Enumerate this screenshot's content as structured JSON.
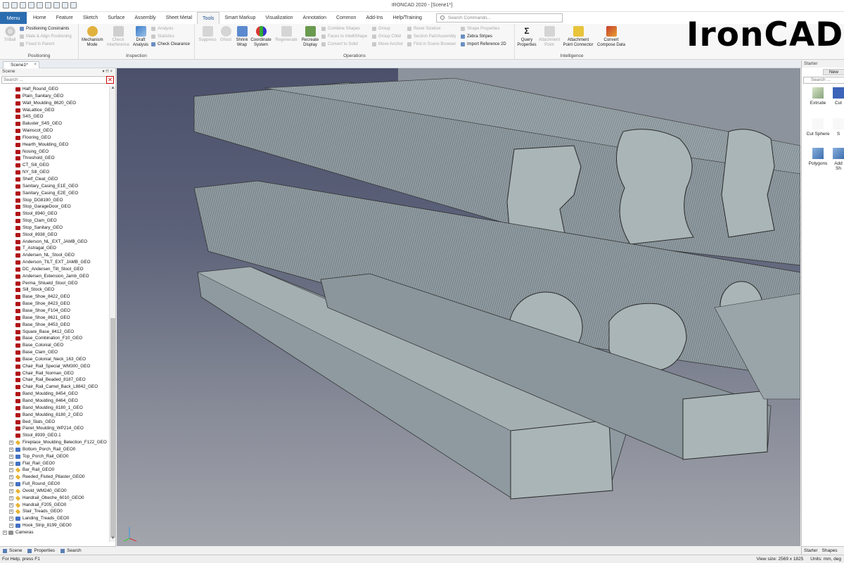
{
  "window": {
    "title": "IRONCAD 2020 - [Scene1*]"
  },
  "menu_button": "Menu",
  "tabs": [
    "Home",
    "Feature",
    "Sketch",
    "Surface",
    "Assembly",
    "Sheet Metal",
    "Tools",
    "Smart Markup",
    "Visualization",
    "Annotation",
    "Common",
    "Add-Ins",
    "Help/Training"
  ],
  "active_tab": "Tools",
  "search_commands": {
    "placeholder": "Search Commands..."
  },
  "logo_text": "IronCAD",
  "ribbon": {
    "positioning": {
      "label": "Positioning",
      "triball": "TriBall",
      "positioning_constraints": "Positioning Constraints",
      "mate_align": "Mate & Align Positioning",
      "fixed_in_parent": "Fixed in Parent"
    },
    "inspection": {
      "label": "Inspection",
      "mechanism_mode": [
        "Mechanism",
        "Mode"
      ],
      "check_interference": [
        "Check",
        "Interference"
      ],
      "draft_analysis": [
        "Draft",
        "Analysis"
      ],
      "analysis": "Analysis",
      "statistics": "Statistics",
      "check_clearance": "Check Clearance"
    },
    "operations": {
      "label": "Operations",
      "suppress": "Suppress",
      "ghost": "Ghost",
      "shrink_wrap": [
        "Shrink",
        "Wrap"
      ],
      "coordinate_system": [
        "Coordinate",
        "System"
      ],
      "regenerate": "Regenerate",
      "recreate_display": [
        "Recreate",
        "Display"
      ],
      "combine_shapes": "Combine Shapes",
      "faces_to_intellishape": "Faces to IntelliShape",
      "convert_to_solid": "Convert to Solid",
      "group": "Group",
      "group_child": "Group Child",
      "move_anchor": "Move Anchor",
      "reset_sizebox": "Reset Sizebox",
      "section_part": "Section Part/Assembly",
      "find_in_scene_browser": "Find in Scene Browser",
      "shape_properties": "Shape Properties",
      "zebra_stripes": "Zebra Stripes",
      "import_reference_2d": "Import Reference 2D"
    },
    "intelligence": {
      "label": "Intelligence",
      "query_properties": [
        "Query",
        "Properties"
      ],
      "attachment_point": [
        "Attachment",
        "Point"
      ],
      "attachment_point_connector": [
        "Attachment",
        "Point Connector"
      ],
      "convert_compose_data": [
        "Convert",
        "Compose Data"
      ]
    }
  },
  "doc_tab": {
    "label": "Scene1*",
    "close": "×"
  },
  "scene_browser": {
    "title": "Scene",
    "pin": "▾ ⊓ ×",
    "search_placeholder": "Search ...",
    "items": [
      {
        "label": "Half_Round_GEO",
        "type": "part"
      },
      {
        "label": "Plain_Sanitary_GEO",
        "type": "part"
      },
      {
        "label": "Wall_Moulding_8620_GEO",
        "type": "part"
      },
      {
        "label": "WaLattice_GEO",
        "type": "part"
      },
      {
        "label": "S4S_GEO",
        "type": "part"
      },
      {
        "label": "Baluster_S4S_GEO",
        "type": "part"
      },
      {
        "label": "Wainscot_GEO",
        "type": "part"
      },
      {
        "label": "Flooring_GEO",
        "type": "part"
      },
      {
        "label": "Hearth_Moulding_GEO",
        "type": "part"
      },
      {
        "label": "Nosing_GEO",
        "type": "part"
      },
      {
        "label": "Threshold_GEO",
        "type": "part"
      },
      {
        "label": "CT_Sill_GEO",
        "type": "part"
      },
      {
        "label": "NY_Sill_GEO",
        "type": "part"
      },
      {
        "label": "Shelf_Cleat_GEO",
        "type": "part"
      },
      {
        "label": "Sanitary_Casing_E1E_GEO",
        "type": "part"
      },
      {
        "label": "Sanitary_Casing_E2E_GEO",
        "type": "part"
      },
      {
        "label": "Stop_DG8190_GEO",
        "type": "part"
      },
      {
        "label": "Stop_GarageDoor_GEO",
        "type": "part"
      },
      {
        "label": "Stool_8940_GEO",
        "type": "part"
      },
      {
        "label": "Stop_Clam_GEO",
        "type": "part"
      },
      {
        "label": "Stop_Sanitary_GEO",
        "type": "part"
      },
      {
        "label": "Stool_8938_GEO",
        "type": "part"
      },
      {
        "label": "Anderson_NL_EXT_JAMB_GEO",
        "type": "part"
      },
      {
        "label": "T_Astragal_GEO",
        "type": "part"
      },
      {
        "label": "Andersen_NL_Stool_GEO",
        "type": "part"
      },
      {
        "label": "Anderson_TILT_EXT_JAMB_GEO",
        "type": "part"
      },
      {
        "label": "DC_Andersen_Tilt_Stool_GEO",
        "type": "part"
      },
      {
        "label": "Andersen_Extension_Jamb_GEO",
        "type": "part"
      },
      {
        "label": "Perma_Shiueld_Stool_GEO",
        "type": "part"
      },
      {
        "label": "Sill_Stock_GEO",
        "type": "part"
      },
      {
        "label": "Base_Shoe_8422_GEO",
        "type": "part"
      },
      {
        "label": "Base_Shoe_8423_GEO",
        "type": "part"
      },
      {
        "label": "Base_Shoe_F104_GEO",
        "type": "part"
      },
      {
        "label": "Base_Shoe_8621_GEO",
        "type": "part"
      },
      {
        "label": "Base_Shoe_8453_GEO",
        "type": "part"
      },
      {
        "label": "Square_Base_8412_GEO",
        "type": "part"
      },
      {
        "label": "Base_Combination_F10_GEO",
        "type": "part"
      },
      {
        "label": "Base_Colonial_GEO",
        "type": "part"
      },
      {
        "label": "Base_Clam_GEO",
        "type": "part"
      },
      {
        "label": "Base_Colonial_Neck_163_GEO",
        "type": "part"
      },
      {
        "label": "Chair_Rail_Special_WM300_GEO",
        "type": "part"
      },
      {
        "label": "Chair_Rail_Norman_GEO",
        "type": "part"
      },
      {
        "label": "Chair_Rail_Beaded_8187_GEO",
        "type": "part"
      },
      {
        "label": "Chair_Rail_Camel_Back_L8842_GEO",
        "type": "part"
      },
      {
        "label": "Band_Moulding_8454_GEO",
        "type": "part"
      },
      {
        "label": "Band_Moulding_8464_GEO",
        "type": "part"
      },
      {
        "label": "Band_Moulding_8180_1_GEO",
        "type": "part"
      },
      {
        "label": "Band_Moulding_8180_2_GEO",
        "type": "part"
      },
      {
        "label": "Bed_Slats_GEO",
        "type": "part"
      },
      {
        "label": "Panel_Moulding_WP214_GEO",
        "type": "part"
      },
      {
        "label": "Stool_8939_GEO.1",
        "type": "part"
      },
      {
        "label": "Fireplace_Moulding_Belection_F122_GEO",
        "type": "asm2",
        "expand": true
      },
      {
        "label": "Bottom_Porch_Rail_GEO0",
        "type": "asm",
        "expand": true
      },
      {
        "label": "Top_Porch_Rail_GEO0",
        "type": "asm",
        "expand": true
      },
      {
        "label": "Flat_Rail_GEO0",
        "type": "asm",
        "expand": true
      },
      {
        "label": "Bar_Rail_GEO0",
        "type": "asm2",
        "expand": true
      },
      {
        "label": "Reeded_Fluted_Pilaster_GEO0",
        "type": "asm2",
        "expand": true
      },
      {
        "label": "Full_Round_GEO0",
        "type": "asm",
        "expand": true
      },
      {
        "label": "Ovold_WM240_GEO0",
        "type": "asm2",
        "expand": true
      },
      {
        "label": "Handrail_Obeche_6010_GEO0",
        "type": "asm2",
        "expand": true
      },
      {
        "label": "Handrail_F205_GEO0",
        "type": "asm2",
        "expand": true
      },
      {
        "label": "Stair_Treads_GEO0",
        "type": "asm2",
        "expand": true
      },
      {
        "label": "Landing_Treads_GEO0",
        "type": "asm",
        "expand": true
      },
      {
        "label": "Hook_Strip_8199_GEO0",
        "type": "asm",
        "expand": true
      },
      {
        "label": "Cameras",
        "type": "cam",
        "expand": true,
        "indent": -1
      }
    ],
    "bottom_tabs": [
      "Scene",
      "Properties",
      "Search"
    ]
  },
  "right_panel": {
    "title": "Starter",
    "new_label": "New",
    "search_placeholder": "Search ...",
    "items": [
      "Extrude",
      "Cut",
      "Cut Sphere",
      "S",
      "Polygons",
      "Add Sh"
    ],
    "bottom_tabs": [
      "Starter",
      "Shapes"
    ]
  },
  "status": {
    "help": "For Help, press F1",
    "view_size": "View size: 2569 x 1825",
    "units": "Units: mm, deg"
  },
  "colors": {
    "menu_blue": "#2b6cb0",
    "part_red": "#b01518",
    "assembly_blue": "#4472c4"
  }
}
